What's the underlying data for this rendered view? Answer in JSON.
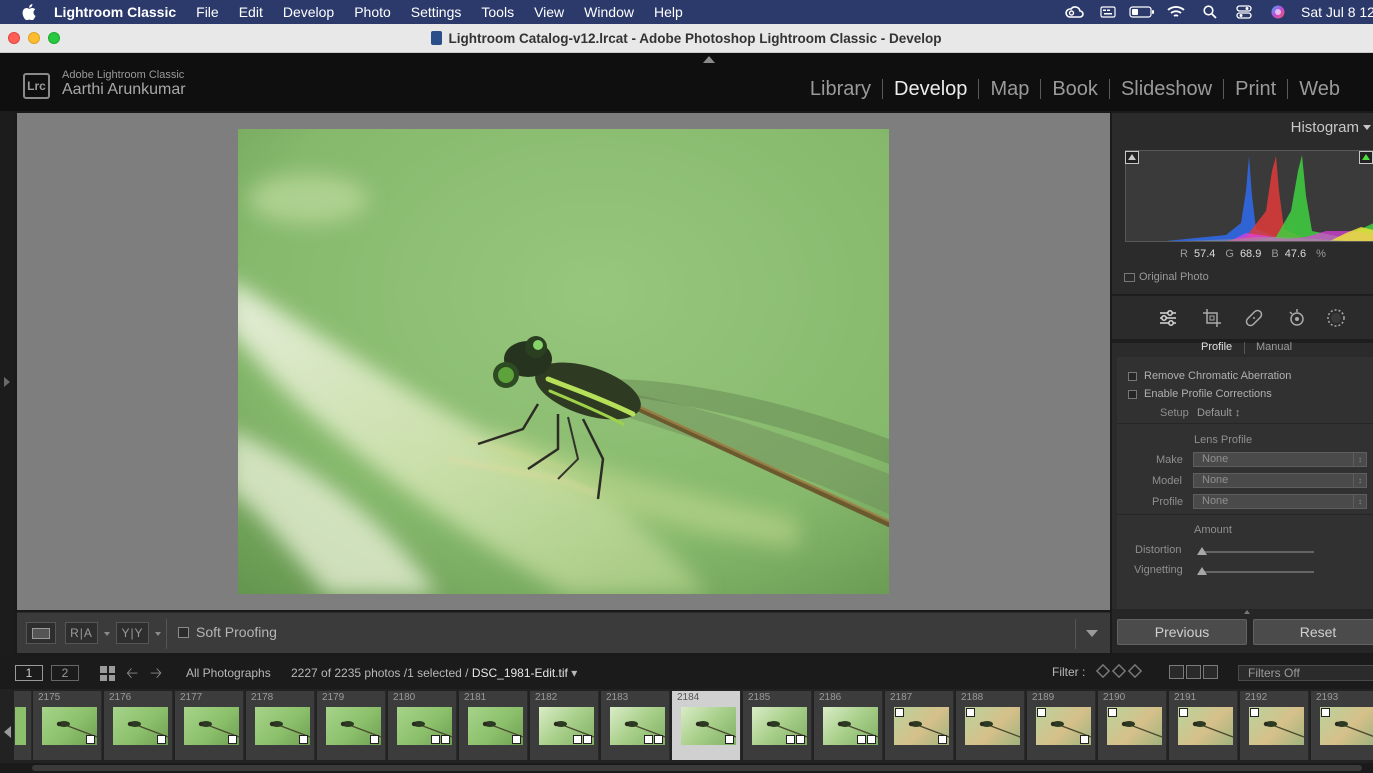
{
  "menubar": {
    "app": "Lightroom Classic",
    "items": [
      "File",
      "Edit",
      "Develop",
      "Photo",
      "Settings",
      "Tools",
      "View",
      "Window",
      "Help"
    ],
    "clock": "Sat Jul 8  12",
    "status_icons": [
      "creative-cloud-icon",
      "keyboard-icon",
      "battery-icon",
      "wifi-icon",
      "spotlight-search-icon",
      "control-center-icon",
      "siri-icon"
    ]
  },
  "window": {
    "title": "Lightroom Catalog-v12.lrcat - Adobe Photoshop Lightroom Classic - Develop"
  },
  "identity": {
    "logo": "Lrc",
    "product": "Adobe Lightroom Classic",
    "user": "Aarthi Arunkumar"
  },
  "modules": [
    "Library",
    "Develop",
    "Map",
    "Book",
    "Slideshow",
    "Print",
    "Web"
  ],
  "active_module": "Develop",
  "toolbar": {
    "ra": "R|A",
    "yy": "Y|Y",
    "soft_proofing": "Soft Proofing"
  },
  "histogram": {
    "title": "Histogram",
    "r_label": "R",
    "r": "57.4",
    "g_label": "G",
    "g": "68.9",
    "b_label": "B",
    "b": "47.6",
    "unit": "%",
    "original_photo": "Original Photo"
  },
  "tools": [
    "edit-sliders-icon",
    "crop-icon",
    "healing-icon",
    "red-eye-icon",
    "masking-icon"
  ],
  "lens": {
    "tab_profile": "Profile",
    "tab_manual": "Manual",
    "remove_ca": "Remove Chromatic Aberration",
    "enable_profile": "Enable Profile Corrections",
    "setup_label": "Setup",
    "setup_value": "Default ↕",
    "lens_profile": "Lens Profile",
    "make_label": "Make",
    "make_value": "None",
    "model_label": "Model",
    "model_value": "None",
    "profile_label": "Profile",
    "profile_value": "None",
    "amount": "Amount",
    "distortion_label": "Distortion",
    "distortion": 0,
    "vignetting_label": "Vignetting",
    "vignetting": 0
  },
  "panel_buttons": {
    "previous": "Previous",
    "reset": "Reset"
  },
  "filmstrip_header": {
    "view1": "1",
    "view2": "2",
    "source": "All Photographs",
    "count": "2227 of 2235 photos /1 selected /",
    "filename": "DSC_1981-Edit.tif",
    "filter_label": "Filter :",
    "filter_value": "Filters Off"
  },
  "filmstrip": {
    "selected": "2184",
    "items": [
      "2175",
      "2176",
      "2177",
      "2178",
      "2179",
      "2180",
      "2181",
      "2182",
      "2183",
      "2184",
      "2185",
      "2186",
      "2187",
      "2188",
      "2189",
      "2190",
      "2191",
      "2192",
      "2193"
    ]
  }
}
